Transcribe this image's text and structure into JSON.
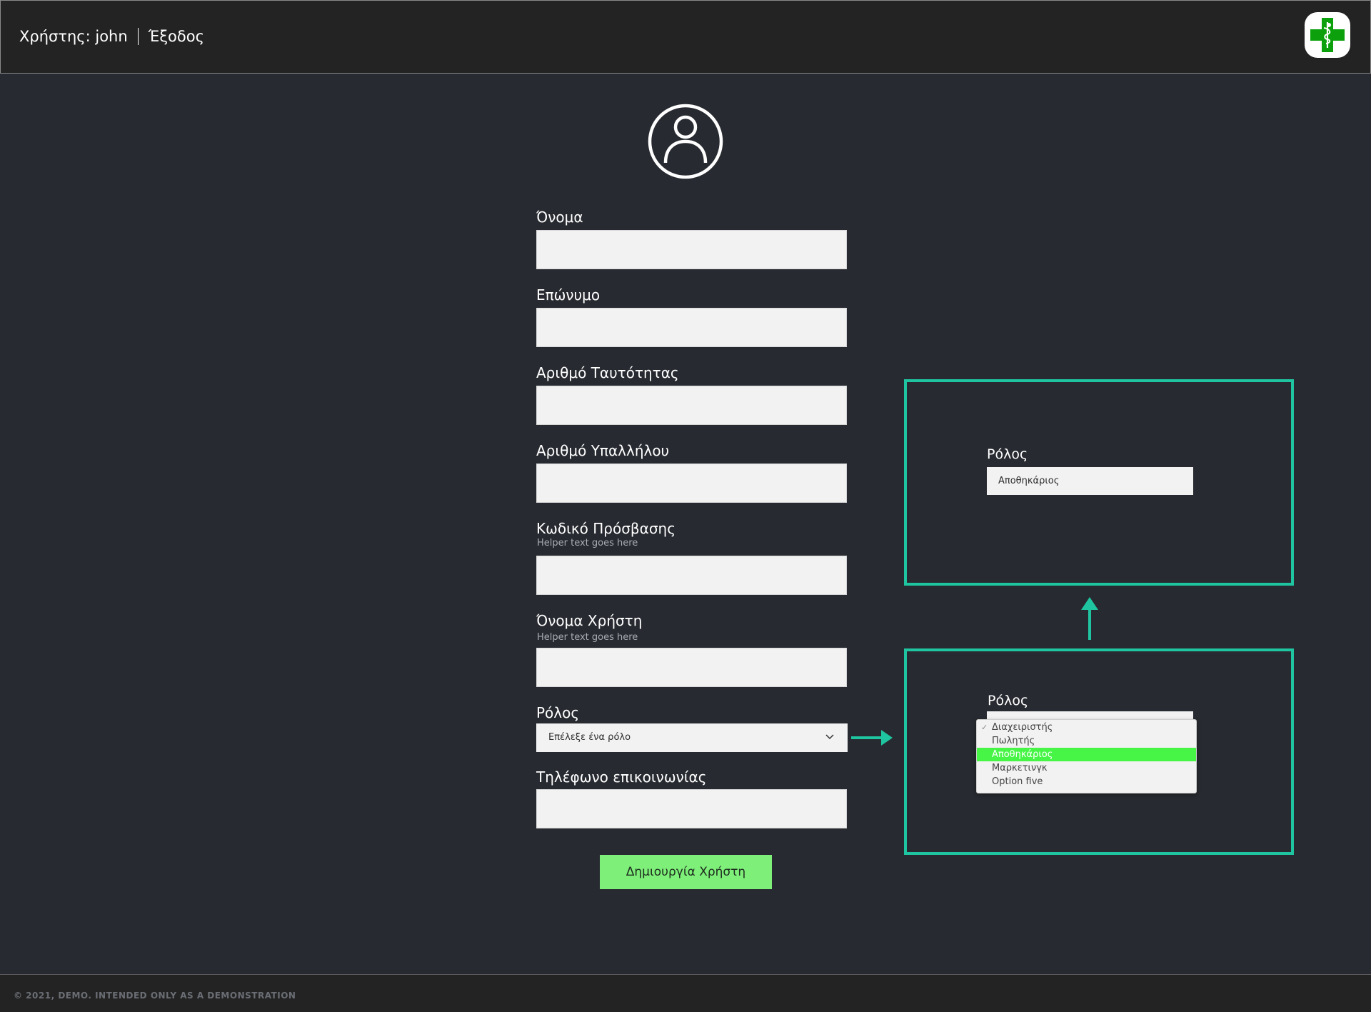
{
  "header": {
    "user_label": "Χρήστης: john",
    "logout_label": "Έξοδος"
  },
  "form": {
    "fields": [
      {
        "label": "Όνομα",
        "value": ""
      },
      {
        "label": "Επώνυμο",
        "value": ""
      },
      {
        "label": "Αριθμό Ταυτότητας",
        "value": ""
      },
      {
        "label": "Αριθμό Υπαλλήλου",
        "value": ""
      },
      {
        "label": "Κωδικό Πρόσβασης",
        "helper": "Helper text goes here",
        "value": ""
      },
      {
        "label": "Όνομα Χρήστη",
        "helper": "Helper text goes here",
        "value": ""
      }
    ],
    "role": {
      "label": "Ρόλος",
      "placeholder": "Επέλεξε ένα ρόλο"
    },
    "phone": {
      "label": "Τηλέφωνο επικοινωνίας",
      "value": ""
    },
    "submit_label": "Δημιουργία Χρήστη"
  },
  "annotation": {
    "selected_box": {
      "label": "Ρόλος",
      "value": "Αποθηκάριος"
    },
    "open_box": {
      "label": "Ρόλος",
      "options": [
        "Διαχειριστής",
        "Πωλητής",
        "Αποθηκάριος",
        "Μαρκετινγκ",
        "Option five"
      ],
      "checked_option": "Διαχειριστής",
      "highlighted_option": "Αποθηκάριος"
    },
    "accent_color": "#1fc5a0"
  },
  "footer": {
    "text": "© 2021, DEMO. INTENDED ONLY AS A DEMONSTRATION"
  },
  "colors": {
    "background": "#272a30",
    "header": "#232323",
    "button": "#7ef07a",
    "highlight": "#46f545",
    "logo_cross": "#0ca00c"
  }
}
